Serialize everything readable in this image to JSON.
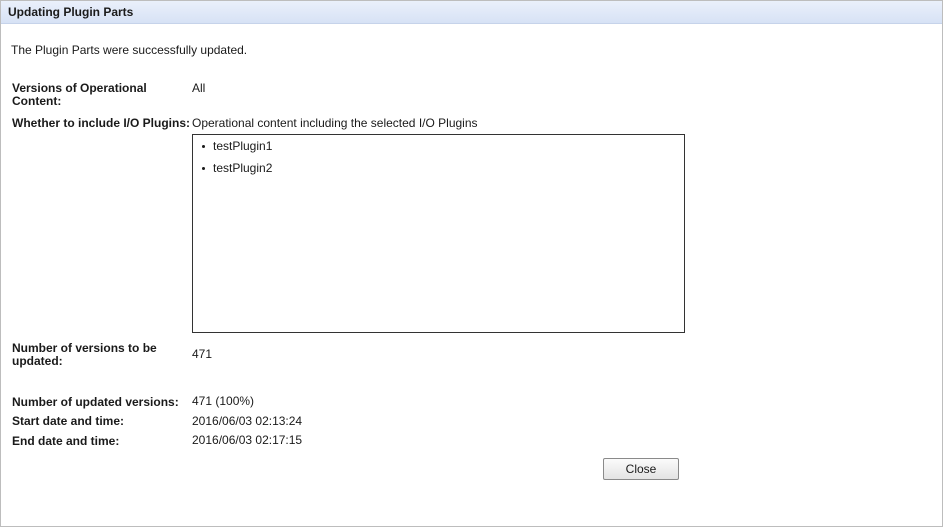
{
  "dialog": {
    "title": "Updating Plugin Parts",
    "message": "The Plugin Parts were successfully updated."
  },
  "fields": {
    "versions_label": "Versions of Operational Content:",
    "versions_value": "All",
    "include_io_label": "Whether to include I/O Plugins:",
    "include_io_value": "Operational content including the selected I/O Plugins",
    "plugins": [
      "testPlugin1",
      "testPlugin2"
    ],
    "num_to_update_label": "Number of versions to be updated:",
    "num_to_update_value": "471",
    "num_updated_label": "Number of updated versions:",
    "num_updated_value": "471 (100%)",
    "start_label": "Start date and time:",
    "start_value": "2016/06/03 02:13:24",
    "end_label": "End date and time:",
    "end_value": "2016/06/03 02:17:15"
  },
  "buttons": {
    "close_label": "Close"
  }
}
